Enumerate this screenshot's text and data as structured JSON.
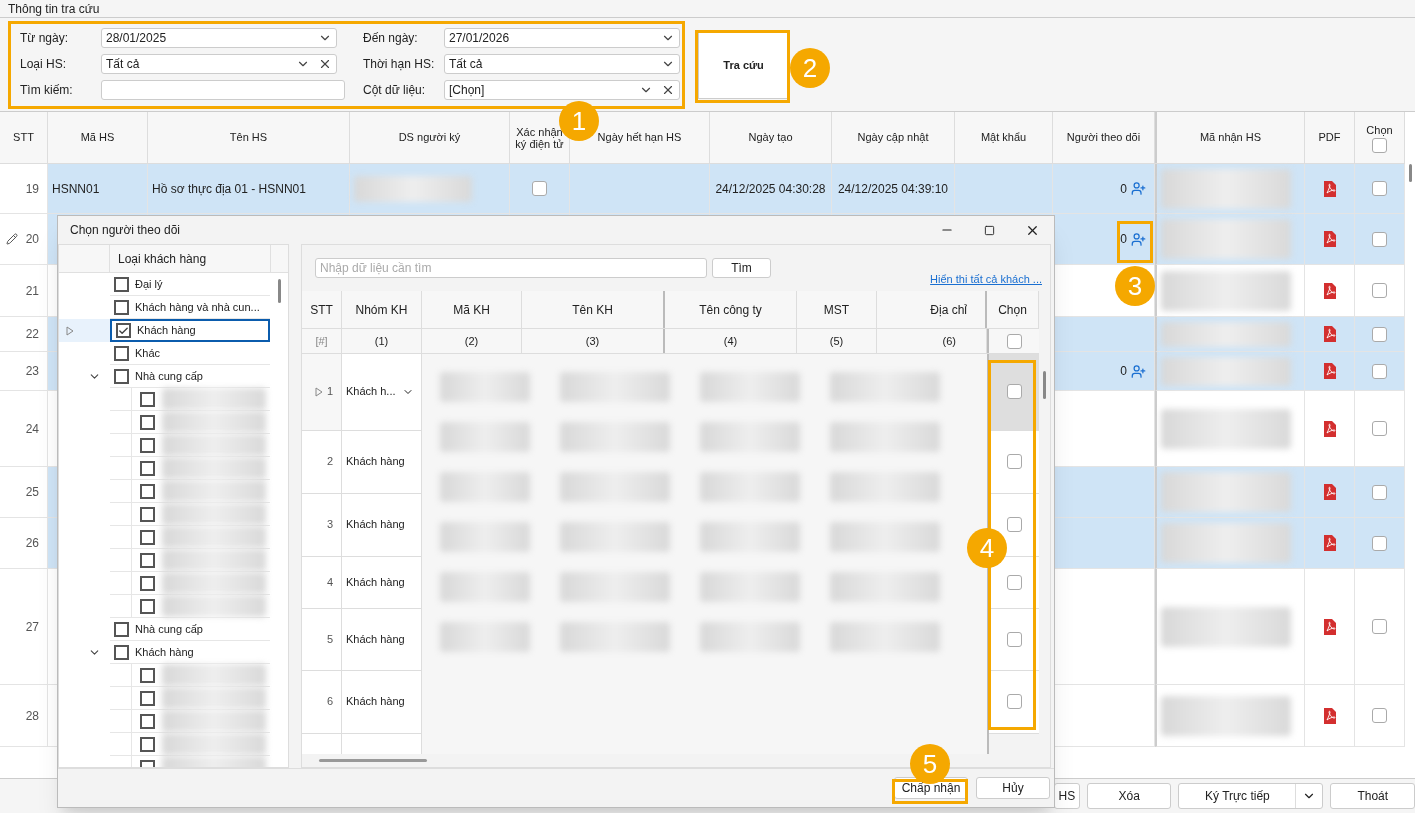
{
  "title": "Thông tin tra cứu",
  "filters": [
    {
      "label": "Từ ngày:",
      "value": "28/01/2025",
      "kind": "dropdown"
    },
    {
      "label": "Loại HS:",
      "value": "Tất cả",
      "kind": "clearable"
    },
    {
      "label": "Tìm kiếm:",
      "kind": "text"
    },
    {
      "label": "Đến ngày:",
      "value": "27/01/2026",
      "kind": "dropdown"
    },
    {
      "label": "Thời hạn HS:",
      "value": "Tất cả",
      "kind": "dropdown"
    },
    {
      "label": "Cột dữ liệu:",
      "value": "[Chọn]",
      "kind": "clearable"
    }
  ],
  "search_button": "Tra cứu",
  "table": {
    "columns": [
      "STT",
      "Mã HS",
      "Tên HS",
      "DS người ký",
      "Xác nhận ký điện tử",
      "Ngày hết hạn HS",
      "Ngày tạo",
      "Ngày cập nhật",
      "Mật khẩu",
      "Người theo dõi",
      "Mã nhận HS",
      "PDF",
      "Chọn"
    ],
    "header_checked": false,
    "rows": [
      {
        "stt": "19",
        "selected": true,
        "editing": false,
        "checked": false,
        "ma_hs": "HSNN01",
        "ten_hs": "Hồ sơ thực địa 01 - HSNN01",
        "xac_nhan": false,
        "ngay_tao": "24/12/2025 04:30:28",
        "ngay_cap_nhat": "24/12/2025 04:39:10",
        "followers": "0"
      },
      {
        "stt": "20",
        "selected": true,
        "editing": true,
        "checked": false,
        "followers": "0"
      },
      {
        "stt": "21",
        "selected": false,
        "editing": false,
        "checked": false
      },
      {
        "stt": "22",
        "selected": true,
        "editing": false,
        "checked": false
      },
      {
        "stt": "23",
        "selected": true,
        "editing": false,
        "checked": false,
        "followers": "0"
      },
      {
        "stt": "24",
        "selected": false,
        "editing": false,
        "checked": false
      },
      {
        "stt": "25",
        "selected": true,
        "editing": false,
        "checked": false
      },
      {
        "stt": "26",
        "selected": true,
        "editing": false,
        "checked": false
      },
      {
        "stt": "27",
        "selected": false,
        "editing": false,
        "checked": false
      },
      {
        "stt": "28",
        "selected": false,
        "editing": false,
        "checked": false
      }
    ]
  },
  "bottom_buttons": [
    {
      "label": "HS",
      "kind": "button"
    },
    {
      "label": "Xóa",
      "kind": "button"
    },
    {
      "label": "Ký Trực tiếp",
      "kind": "split"
    },
    {
      "label": "Thoát",
      "kind": "button"
    }
  ],
  "dialog": {
    "title": "Chọn người theo dõi",
    "tree": {
      "header": "Loại khách hàng",
      "items": [
        {
          "label": "Đại lý",
          "checked": false,
          "selected": false
        },
        {
          "label": "Khách hàng và nhà cun...",
          "checked": false,
          "selected": false
        },
        {
          "label": "Khách hàng",
          "checked": true,
          "selected": true
        },
        {
          "label": "Khác",
          "checked": false,
          "selected": false
        },
        {
          "label": "Nhà cung cấp",
          "checked": false,
          "selected": false,
          "expanded": true,
          "children": [
            {
              "checked": false,
              "selected": false
            },
            {
              "checked": false,
              "selected": false
            },
            {
              "checked": false,
              "selected": false
            },
            {
              "checked": false,
              "selected": false
            },
            {
              "checked": false,
              "selected": false
            },
            {
              "checked": false,
              "selected": false
            },
            {
              "checked": false,
              "selected": false
            },
            {
              "checked": false,
              "selected": false
            },
            {
              "checked": false,
              "selected": false
            },
            {
              "checked": false,
              "selected": false
            }
          ]
        },
        {
          "label": "Nhà cung cấp",
          "checked": false,
          "selected": false
        },
        {
          "label": "Khách hàng",
          "checked": false,
          "selected": false,
          "expanded": true,
          "children": [
            {
              "checked": false,
              "selected": false
            },
            {
              "checked": false,
              "selected": false
            },
            {
              "checked": false,
              "selected": false
            },
            {
              "checked": false,
              "selected": false
            },
            {
              "checked": false,
              "selected": false
            }
          ]
        }
      ]
    },
    "search": {
      "placeholder": "Nhập dữ liệu cần tìm"
    },
    "find_button": "Tìm",
    "show_all_link": "Hiển thi tất cả khách ...",
    "grid": {
      "columns": [
        "STT",
        "Nhóm KH",
        "Mã KH",
        "Tên KH",
        "Tên công ty",
        "MST",
        "Địa chỉ",
        "Chọn"
      ],
      "filter_row": [
        "[#]",
        "(1)",
        "(2)",
        "(3)",
        "(4)",
        "(5)",
        "(6)"
      ],
      "filter_checked": false,
      "rows": [
        {
          "stt": "1",
          "group": "Khách h...",
          "kind": "dropdown",
          "selected": true,
          "checked": false
        },
        {
          "stt": "2",
          "group": "Khách hàng",
          "kind": "text",
          "selected": false,
          "checked": false
        },
        {
          "stt": "3",
          "group": "Khách hàng",
          "kind": "text",
          "selected": false,
          "checked": false
        },
        {
          "stt": "4",
          "group": "Khách hàng",
          "kind": "text",
          "selected": false,
          "checked": false
        },
        {
          "stt": "5",
          "group": "Khách hàng",
          "kind": "text",
          "selected": false,
          "checked": false
        },
        {
          "stt": "6",
          "group": "Khách hàng",
          "kind": "text",
          "selected": false,
          "checked": false
        }
      ]
    },
    "buttons": [
      "Chấp nhận",
      "Hủy"
    ]
  },
  "callouts": [
    "1",
    "2",
    "3",
    "4",
    "5"
  ]
}
